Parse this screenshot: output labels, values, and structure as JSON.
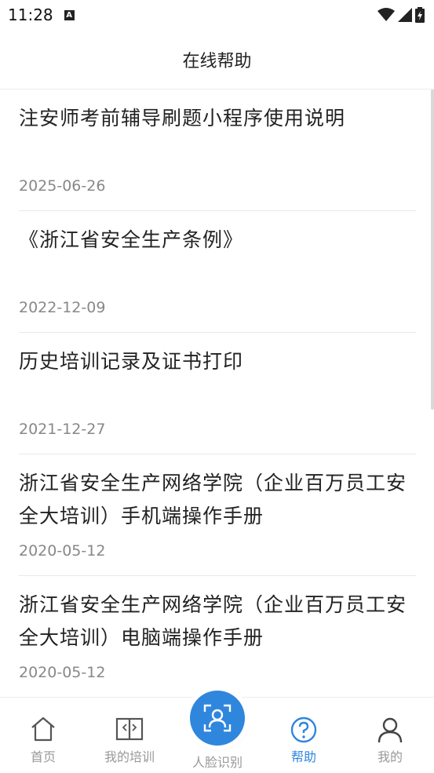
{
  "status_bar": {
    "time": "11:28",
    "notif_icon": "A"
  },
  "header": {
    "title": "在线帮助"
  },
  "articles": [
    {
      "title": "注安师考前辅导刷题小程序使用说明",
      "date": "2025-06-26"
    },
    {
      "title": "《浙江省安全生产条例》",
      "date": "2022-12-09"
    },
    {
      "title": "历史培训记录及证书打印",
      "date": "2021-12-27"
    },
    {
      "title": "浙江省安全生产网络学院（企业百万员工安全大培训）手机端操作手册",
      "date": "2020-05-12"
    },
    {
      "title": "浙江省安全生产网络学院（企业百万员工安全大培训）电脑端操作手册",
      "date": "2020-05-12"
    }
  ],
  "tabbar": {
    "home": "首页",
    "training": "我的培训",
    "face": "人脸识别",
    "help": "帮助",
    "mine": "我的"
  },
  "colors": {
    "accent": "#2f86dd",
    "inactive": "#999999"
  }
}
